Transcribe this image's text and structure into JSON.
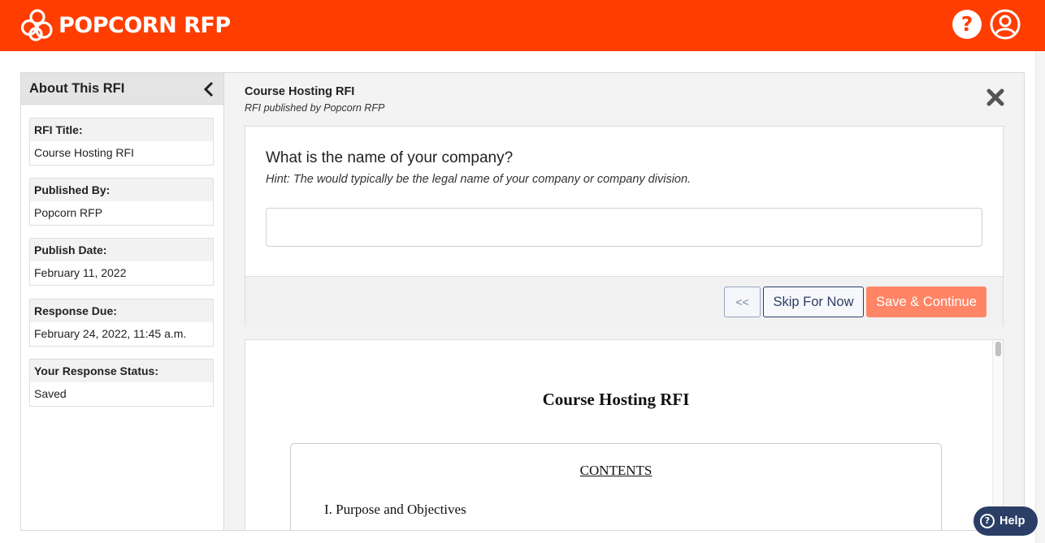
{
  "app": {
    "brand": "POPCORN RFP",
    "help_icon_glyph": "?",
    "accent_color": "#ff3d00"
  },
  "sidebar": {
    "title": "About This RFI",
    "fields": [
      {
        "label": "RFI Title:",
        "value": "Course Hosting RFI"
      },
      {
        "label": "Published By:",
        "value": "Popcorn RFP"
      },
      {
        "label": "Publish Date:",
        "value": "February 11, 2022"
      },
      {
        "label": "Response Due:",
        "value": "February 24, 2022, 11:45 a.m."
      },
      {
        "label": "Your Response Status:",
        "value": "Saved"
      }
    ]
  },
  "main": {
    "title": "Course Hosting RFI",
    "subtitle": "RFI published by Popcorn RFP",
    "question": {
      "text": "What is the name of your company?",
      "hint": "Hint: The would typically be the legal name of your company or company division.",
      "answer_value": "",
      "answer_placeholder": ""
    },
    "buttons": {
      "prev": "<<",
      "skip": "Skip For Now",
      "save": "Save & Continue"
    },
    "document": {
      "title": "Course Hosting RFI",
      "toc_heading": "CONTENTS",
      "toc_items": [
        "I. Purpose and Objectives"
      ]
    }
  },
  "help_widget": {
    "label": "Help"
  }
}
